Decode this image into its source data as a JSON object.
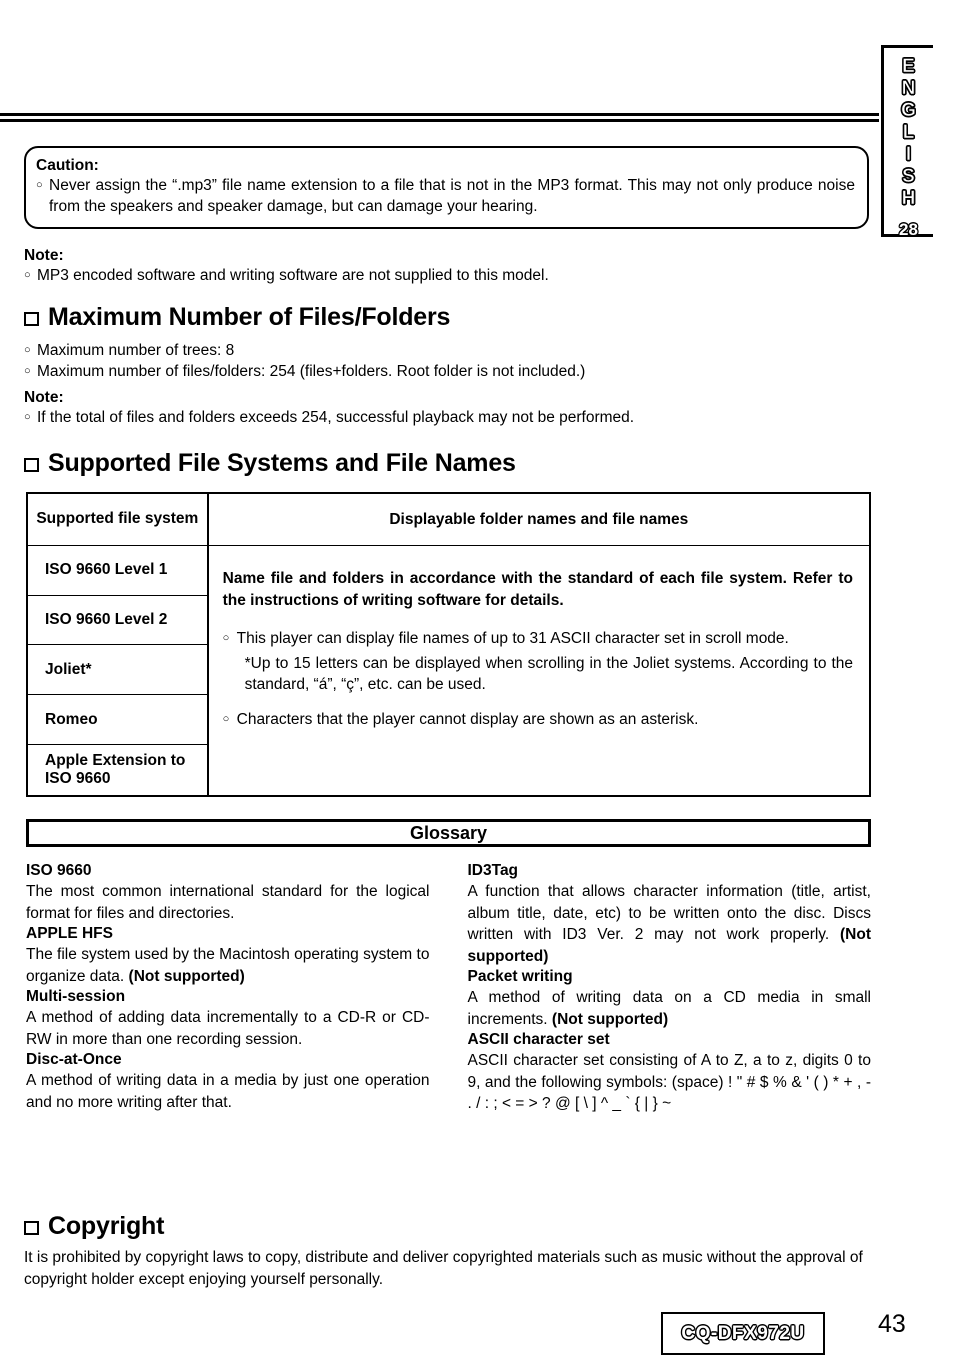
{
  "side_tab": {
    "language": "ENGLISH",
    "number": "28"
  },
  "caution": {
    "title": "Caution:",
    "bullet_mark": "○",
    "text": "Never assign the “.mp3” file name extension to a file that is not in the MP3 format. This may not only produce noise from the speakers and speaker damage, but can damage your hearing."
  },
  "note1": {
    "title": "Note:",
    "bullet_mark": "○",
    "text": "MP3 encoded software and writing software are not supplied to this model."
  },
  "section_max_files": {
    "heading": "Maximum Number of Files/Folders",
    "bullet_mark": "○",
    "items": [
      "Maximum number of trees: 8",
      "Maximum number of files/folders: 254 (files+folders. Root folder is not included.)"
    ]
  },
  "note2": {
    "title": "Note:",
    "bullet_mark": "○",
    "text": "If the total of files and folders exceeds 254, successful playback may not be performed."
  },
  "section_file_systems": {
    "heading": "Supported File Systems and File Names",
    "table": {
      "headers": [
        "Supported file system",
        "Displayable folder names and file names"
      ],
      "rows": [
        "ISO 9660 Level 1",
        "ISO 9660 Level 2",
        "Joliet*",
        "Romeo",
        "Apple Extension to ISO 9660"
      ],
      "body": {
        "bold_para": "Name file and folders in accordance with the standard of each file system. Refer to the instructions of writing software for details.",
        "bullet_mark": "○",
        "bullet1": "This player can display file names of up to 31 ASCII character set in scroll mode.",
        "bullet1_sub": "*Up to 15 letters can be displayed when scrolling in the Joliet systems. According to the standard, “á”, “ç”, etc. can be used.",
        "bullet2": "Characters that the player cannot display are shown as an asterisk."
      }
    }
  },
  "glossary": {
    "title": "Glossary",
    "left_column": [
      {
        "term": "ISO 9660",
        "definition": "The most common international standard for the logical format for files and directories.",
        "suffix": ""
      },
      {
        "term": "APPLE HFS",
        "definition": "The file system used by the Macintosh operating system to organize data. ",
        "suffix": "(Not supported)"
      },
      {
        "term": "Multi-session",
        "definition": "A method of adding data incrementally to a CD-R or CD-RW in more than one recording session.",
        "suffix": ""
      },
      {
        "term": "Disc-at-Once",
        "definition": "A method of writing data in a media by just one operation and no more writing after that.",
        "suffix": ""
      }
    ],
    "right_column": [
      {
        "term": "ID3Tag",
        "definition": "A function that allows character information (title, artist, album title, date, etc) to be written onto the disc. Discs written with ID3 Ver. 2 may not work properly. ",
        "suffix": "(Not supported)"
      },
      {
        "term": "Packet writing",
        "definition": "A method of writing data on a CD media in small increments. ",
        "suffix": "(Not supported)"
      },
      {
        "term": "ASCII character set",
        "definition": "ASCII character set consisting of A to Z, a to z, digits 0 to 9, and the following symbols: (space) ! \" # $ % & ' ( ) * + , - . / : ; < = > ? @ [ \\ ] ^ _ ` { | } ~",
        "suffix": ""
      }
    ]
  },
  "section_copyright": {
    "heading": "Copyright",
    "body": "It is prohibited by copyright laws to copy, distribute and deliver copyrighted materials such as music without the approval of copyright holder except enjoying yourself personally."
  },
  "footer": {
    "model": "CQ-DFX972U",
    "page_number": "43"
  }
}
